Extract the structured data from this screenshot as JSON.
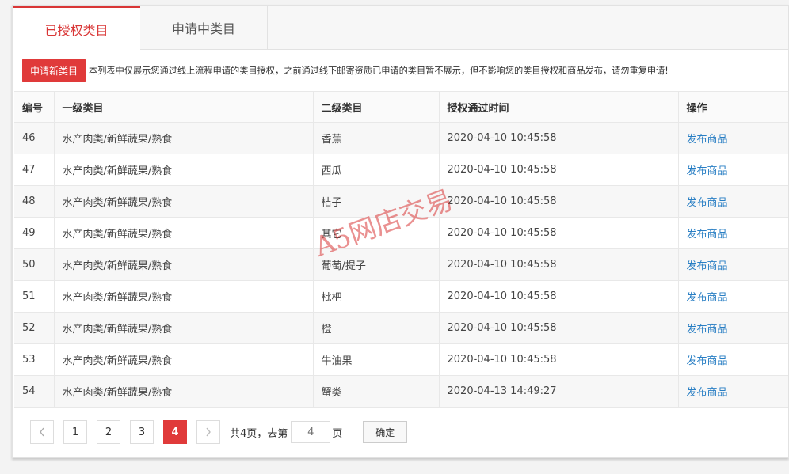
{
  "tabs": [
    {
      "label": "已授权类目"
    },
    {
      "label": "申请中类目"
    }
  ],
  "notice": {
    "button_label": "申请新类目",
    "text": "本列表中仅展示您通过线上流程申请的类目授权，之前通过线下邮寄资质已申请的类目暂不展示，但不影响您的类目授权和商品发布，请勿重复申请!"
  },
  "table": {
    "columns": [
      "编号",
      "一级类目",
      "二级类目",
      "授权通过时间",
      "操作"
    ],
    "rows": [
      {
        "id": "46",
        "level1": "水产肉类/新鲜蔬果/熟食",
        "level2": "香蕉",
        "time": "2020-04-10 10:45:58",
        "action": "发布商品"
      },
      {
        "id": "47",
        "level1": "水产肉类/新鲜蔬果/熟食",
        "level2": "西瓜",
        "time": "2020-04-10 10:45:58",
        "action": "发布商品"
      },
      {
        "id": "48",
        "level1": "水产肉类/新鲜蔬果/熟食",
        "level2": "桔子",
        "time": "2020-04-10 10:45:58",
        "action": "发布商品"
      },
      {
        "id": "49",
        "level1": "水产肉类/新鲜蔬果/熟食",
        "level2": "其它",
        "time": "2020-04-10 10:45:58",
        "action": "发布商品"
      },
      {
        "id": "50",
        "level1": "水产肉类/新鲜蔬果/熟食",
        "level2": "葡萄/提子",
        "time": "2020-04-10 10:45:58",
        "action": "发布商品"
      },
      {
        "id": "51",
        "level1": "水产肉类/新鲜蔬果/熟食",
        "level2": "枇杷",
        "time": "2020-04-10 10:45:58",
        "action": "发布商品"
      },
      {
        "id": "52",
        "level1": "水产肉类/新鲜蔬果/熟食",
        "level2": "橙",
        "time": "2020-04-10 10:45:58",
        "action": "发布商品"
      },
      {
        "id": "53",
        "level1": "水产肉类/新鲜蔬果/熟食",
        "level2": "牛油果",
        "time": "2020-04-10 10:45:58",
        "action": "发布商品"
      },
      {
        "id": "54",
        "level1": "水产肉类/新鲜蔬果/熟食",
        "level2": "蟹类",
        "time": "2020-04-13 14:49:27",
        "action": "发布商品"
      }
    ]
  },
  "pagination": {
    "prev_icon": "chevron-left-icon",
    "next_icon": "chevron-right-icon",
    "pages": [
      "1",
      "2",
      "3",
      "4"
    ],
    "current": "4",
    "total_text": "共4页，去第",
    "input_placeholder": "4",
    "page_suffix": "页",
    "confirm_label": "确定"
  },
  "watermark": "A5网店交易",
  "colors": {
    "accent": "#e03a3a",
    "link": "#2a7fc4"
  }
}
